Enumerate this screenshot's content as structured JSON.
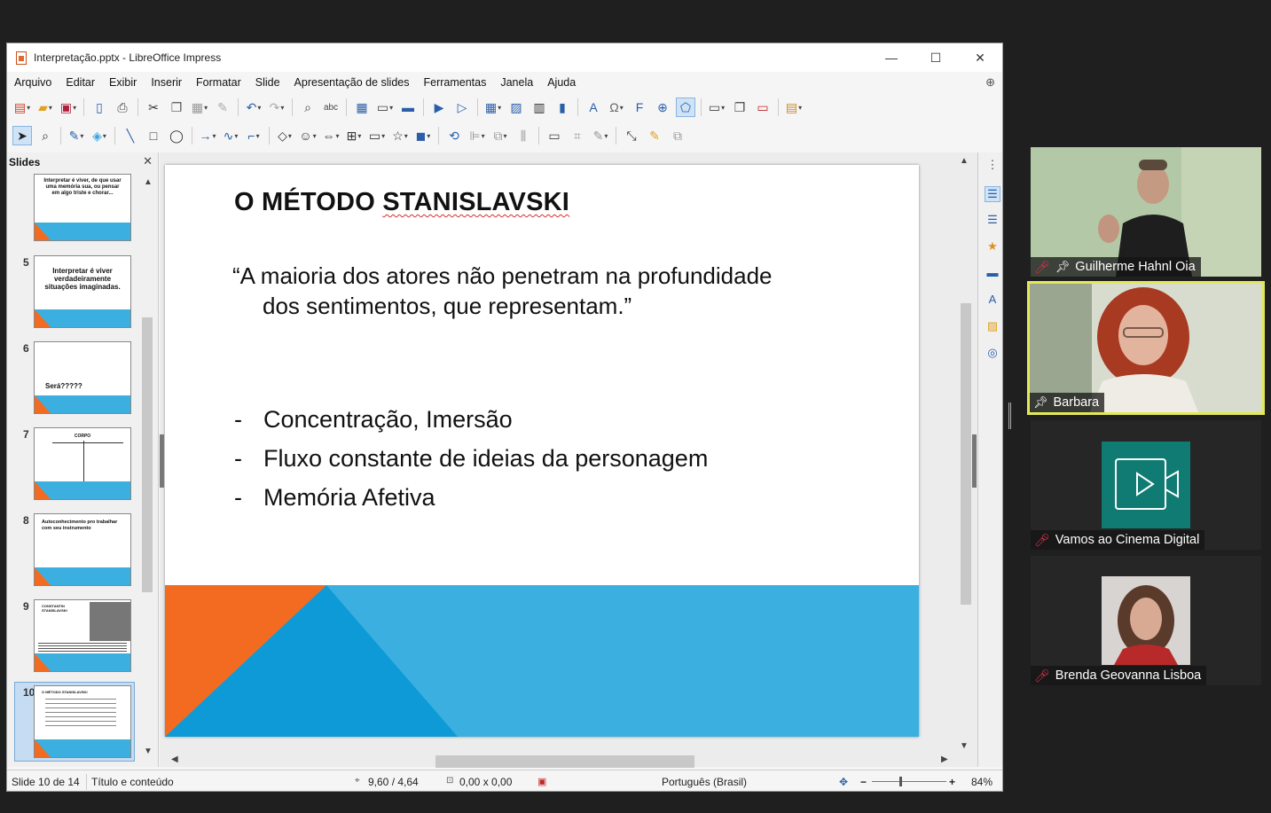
{
  "window": {
    "title": "Interpretação.pptx - LibreOffice Impress",
    "controls": [
      "—",
      "☐",
      "✕"
    ]
  },
  "menu": [
    "Arquivo",
    "Editar",
    "Exibir",
    "Inserir",
    "Formatar",
    "Slide",
    "Apresentação de slides",
    "Ferramentas",
    "Janela",
    "Ajuda"
  ],
  "slides_pane": {
    "title": "Slides",
    "thumbnails": [
      {
        "num": "",
        "text": "Interpretar é viver, de que usar uma memória sua, ou pensar em algo triste e chorar..."
      },
      {
        "num": "5",
        "text": "Interpretar é viver verdadeiramente situações imaginadas."
      },
      {
        "num": "6",
        "text": "Será?????"
      },
      {
        "num": "7",
        "text": "CORPO"
      },
      {
        "num": "8",
        "text": "Autoconhecimento pro trabalhar com seu instrumento"
      },
      {
        "num": "9",
        "text": "CONSTANTIN STANISLAVSKI"
      },
      {
        "num": "10",
        "text": "O MÉTODO STANISLAVSKI"
      }
    ]
  },
  "slide": {
    "title_prefix": "O MÉTODO ",
    "title_word": "STANISLAVSKI",
    "quote_line1": "“A maioria dos atores não penetram na profundidade",
    "quote_line2": "dos sentimentos, que representam.”",
    "bullet_dash": "-",
    "bullets": [
      "Concentração, Imersão",
      "Fluxo constante de ideias da personagem",
      "Memória Afetiva"
    ],
    "colors": {
      "orange": "#f26b21",
      "blue_light": "#3bb0e0",
      "blue_dark": "#0e9ad6"
    }
  },
  "statusbar": {
    "slide_info": "Slide 10 de 14",
    "layout": "Título e conteúdo",
    "position": "9,60 / 4,64",
    "size": "0,00 x 0,00",
    "language": "Português (Brasil)",
    "zoom": "84%"
  },
  "participants": [
    {
      "name": "Guilherme Hahnl Oia",
      "muted": true,
      "pinned": true
    },
    {
      "name": "Barbara",
      "muted": false,
      "pinned": true,
      "active_speaker": true
    },
    {
      "name": "Vamos ao Cinema Digital",
      "muted": true,
      "pinned": false
    },
    {
      "name": "Brenda Geovanna Lisboa",
      "muted": true,
      "pinned": false
    }
  ]
}
